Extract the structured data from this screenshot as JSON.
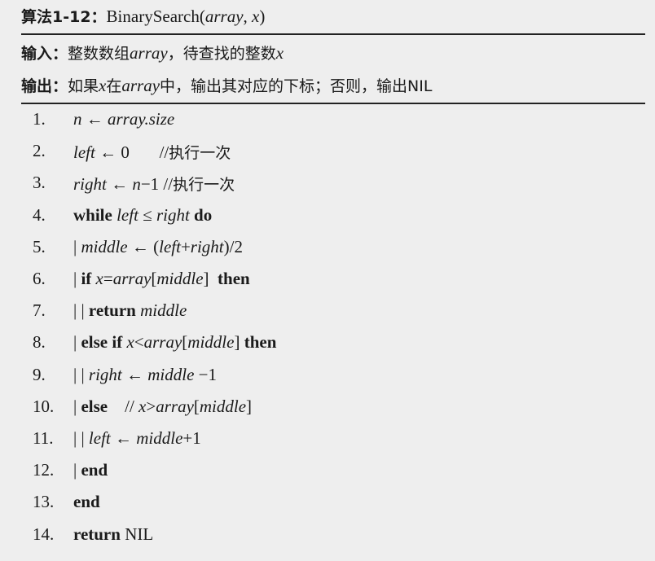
{
  "header": {
    "algo_label": "算法1-12：",
    "algo_name": "BinarySearch(",
    "algo_arg1": "array",
    "algo_sep": ", ",
    "algo_arg2": "x",
    "algo_close": ")"
  },
  "input": {
    "label": "输入：",
    "text1": "整数数组",
    "var1": "array",
    "text2": "，待查找的整数",
    "var2": "x"
  },
  "output": {
    "label": "输出：",
    "text1": "如果",
    "var1": "x",
    "text2": "在",
    "var2": "array",
    "text3": "中，输出其对应的下标；否则，输出NIL"
  },
  "lines": [
    {
      "num": "1.",
      "parts": [
        {
          "t": "n",
          "s": "i"
        },
        {
          "t": " ← ",
          "s": ""
        },
        {
          "t": "array.size",
          "s": "i"
        }
      ]
    },
    {
      "num": "2.",
      "parts": [
        {
          "t": "left",
          "s": "i"
        },
        {
          "t": " ← 0       ",
          "s": ""
        },
        {
          "t": "//",
          "s": ""
        },
        {
          "t": "执行一次",
          "s": "zh"
        }
      ]
    },
    {
      "num": "3.",
      "parts": [
        {
          "t": "right",
          "s": "i"
        },
        {
          "t": " ← ",
          "s": ""
        },
        {
          "t": "n",
          "s": "i"
        },
        {
          "t": "−1 //",
          "s": ""
        },
        {
          "t": "执行一次",
          "s": "zh"
        }
      ]
    },
    {
      "num": "4.",
      "parts": [
        {
          "t": "while ",
          "s": "b"
        },
        {
          "t": "left",
          "s": "i"
        },
        {
          "t": " ≤ ",
          "s": ""
        },
        {
          "t": "right",
          "s": "i"
        },
        {
          "t": " do",
          "s": "b"
        }
      ]
    },
    {
      "num": "5.",
      "parts": [
        {
          "t": "| ",
          "s": ""
        },
        {
          "t": "middle",
          "s": "i"
        },
        {
          "t": " ← (",
          "s": ""
        },
        {
          "t": "left",
          "s": "i"
        },
        {
          "t": "+",
          "s": ""
        },
        {
          "t": "right",
          "s": "i"
        },
        {
          "t": ")/2",
          "s": ""
        }
      ]
    },
    {
      "num": "6.",
      "parts": [
        {
          "t": "| ",
          "s": ""
        },
        {
          "t": "if ",
          "s": "b"
        },
        {
          "t": "x",
          "s": "i"
        },
        {
          "t": "=",
          "s": ""
        },
        {
          "t": "array",
          "s": "i"
        },
        {
          "t": "[",
          "s": ""
        },
        {
          "t": "middle",
          "s": "i"
        },
        {
          "t": "]  ",
          "s": ""
        },
        {
          "t": "then",
          "s": "b"
        }
      ]
    },
    {
      "num": "7.",
      "parts": [
        {
          "t": "| | ",
          "s": ""
        },
        {
          "t": "return ",
          "s": "b"
        },
        {
          "t": "middle",
          "s": "i"
        }
      ]
    },
    {
      "num": "8.",
      "parts": [
        {
          "t": "| ",
          "s": ""
        },
        {
          "t": "else if ",
          "s": "b"
        },
        {
          "t": "x",
          "s": "i"
        },
        {
          "t": "<",
          "s": ""
        },
        {
          "t": "array",
          "s": "i"
        },
        {
          "t": "[",
          "s": ""
        },
        {
          "t": "middle",
          "s": "i"
        },
        {
          "t": "] ",
          "s": ""
        },
        {
          "t": "then",
          "s": "b"
        }
      ]
    },
    {
      "num": "9.",
      "parts": [
        {
          "t": "| | ",
          "s": ""
        },
        {
          "t": "right",
          "s": "i"
        },
        {
          "t": " ← ",
          "s": ""
        },
        {
          "t": "middle",
          "s": "i"
        },
        {
          "t": " −1",
          "s": ""
        }
      ]
    },
    {
      "num": "10.",
      "parts": [
        {
          "t": "| ",
          "s": ""
        },
        {
          "t": "else",
          "s": "b"
        },
        {
          "t": "    // ",
          "s": ""
        },
        {
          "t": "x",
          "s": "i"
        },
        {
          "t": ">",
          "s": ""
        },
        {
          "t": "array",
          "s": "i"
        },
        {
          "t": "[",
          "s": ""
        },
        {
          "t": "middle",
          "s": "i"
        },
        {
          "t": "]",
          "s": ""
        }
      ]
    },
    {
      "num": "11.",
      "parts": [
        {
          "t": "| | ",
          "s": ""
        },
        {
          "t": "left",
          "s": "i"
        },
        {
          "t": " ← ",
          "s": ""
        },
        {
          "t": "middle",
          "s": "i"
        },
        {
          "t": "+1",
          "s": ""
        }
      ]
    },
    {
      "num": "12.",
      "parts": [
        {
          "t": "| ",
          "s": ""
        },
        {
          "t": "end",
          "s": "b"
        }
      ]
    },
    {
      "num": "13.",
      "parts": [
        {
          "t": "end",
          "s": "b"
        }
      ]
    },
    {
      "num": "14.",
      "parts": [
        {
          "t": "return ",
          "s": "b"
        },
        {
          "t": "NIL",
          "s": ""
        }
      ]
    }
  ]
}
